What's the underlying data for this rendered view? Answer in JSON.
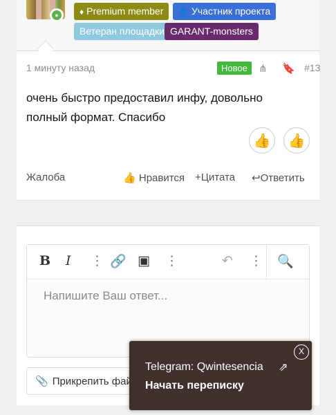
{
  "user": {
    "badges": [
      {
        "label": "Premium member",
        "icon": "diamond-icon"
      },
      {
        "label": "Участник проекта",
        "icon": "user-icon"
      },
      {
        "label": "Ветеран площадки"
      },
      {
        "label": "GARANT-monsters"
      }
    ]
  },
  "post": {
    "time": "1 минуту назад",
    "new_label": "Новое",
    "number": "#13",
    "message": "очень быстро предоставил инфу, довольно полный формат. Спасибо",
    "actions": {
      "report": "Жалоба",
      "like": "Нравится",
      "quote": "Цитата",
      "reply": "Ответить"
    }
  },
  "editor": {
    "placeholder": "Напишите Ваш ответ...",
    "attach_label": "Прикрепить файлы"
  },
  "popup": {
    "telegram": "Telegram: Qwintesencia",
    "start_chat": "Начать переписку",
    "close": "X"
  },
  "colors": {
    "premium": "#8c8c14",
    "member": "#3b6fd8",
    "veteran": "#8ec9e0",
    "garant": "#6a2a6e",
    "new": "#43b83a",
    "popup_bg": "#40312f"
  }
}
